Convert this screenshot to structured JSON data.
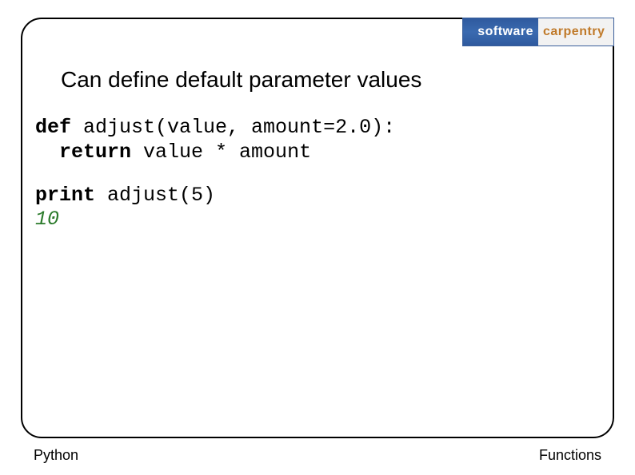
{
  "logo": {
    "left": "software",
    "right": "carpentry"
  },
  "heading": "Can define default parameter values",
  "code": {
    "line1_kw": "def",
    "line1_rest": " adjust(value, amount=2.0):",
    "line2_indent": "  ",
    "line2_kw": "return",
    "line2_rest": " value * amount",
    "line3_kw": "print",
    "line3_rest": " adjust(5)",
    "output": "10"
  },
  "footer": {
    "left": "Python",
    "right": "Functions"
  }
}
